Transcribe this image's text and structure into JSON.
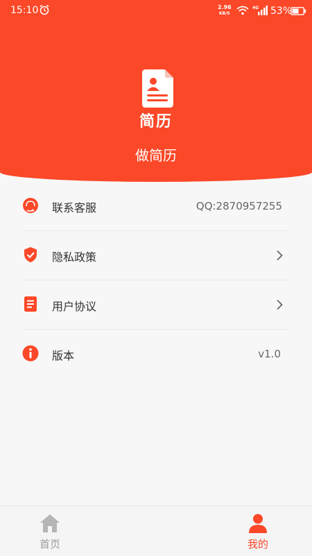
{
  "status_bar": {
    "time": "15:10",
    "net_speed": "2.96",
    "net_unit": "KB/S",
    "network_type": "4G",
    "battery": "53%"
  },
  "header": {
    "icon_title": "简历",
    "app_name": "做简历",
    "background_color": "#fb4828"
  },
  "menu": [
    {
      "label": "联系客服",
      "value": "QQ:2870957255",
      "icon": "headset-icon"
    },
    {
      "label": "隐私政策",
      "value": "",
      "icon": "shield-check-icon"
    },
    {
      "label": "用户协议",
      "value": "",
      "icon": "document-icon"
    },
    {
      "label": "版本",
      "value": "v1.0",
      "icon": "info-icon"
    }
  ],
  "bottom_nav": {
    "tabs": [
      {
        "label": "首页",
        "icon": "home-icon",
        "active": false
      },
      {
        "label": "我的",
        "icon": "user-icon",
        "active": true
      }
    ]
  }
}
